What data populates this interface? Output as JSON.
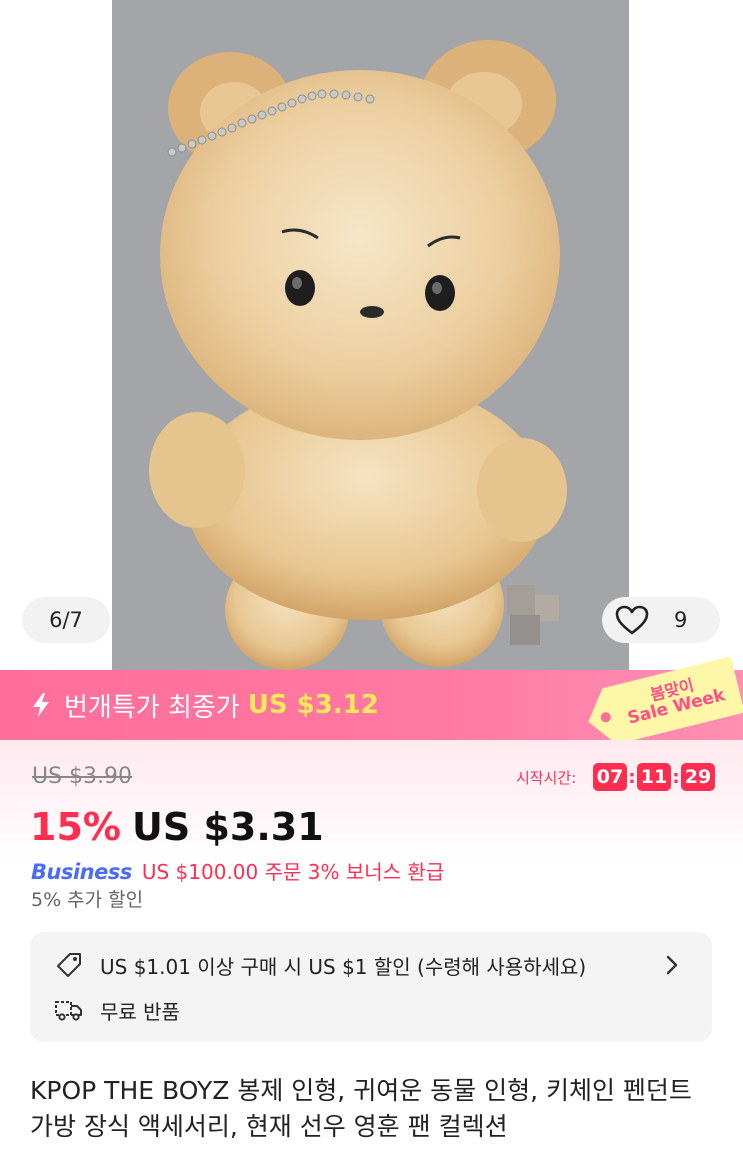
{
  "gallery": {
    "counter": "6/7",
    "favorites_count": "9"
  },
  "flash_sale": {
    "label": "번개특가 최종가",
    "price": "US $3.12"
  },
  "promo_tag": {
    "line1": "봄맞이",
    "line2": "Sale Week"
  },
  "pricing": {
    "original_price": "US $3.90",
    "start_label": "시작시간:",
    "timer": {
      "hours": "07",
      "minutes": "11",
      "seconds": "29"
    },
    "discount": "15%",
    "current_price": "US $3.31",
    "business_logo": "Business",
    "business_text": "US $100.00 주문 3% 보너스 환급",
    "extra_discount": "5% 추가 할인"
  },
  "coupon": {
    "row1": "US $1.01 이상 구매 시 US $1 할인 (수령해 사용하세요)",
    "row2": "무료 반품"
  },
  "product": {
    "title": "KPOP THE BOYZ 봉제 인형, 귀여운 동물 인형, 키체인 펜던트 가방 장식 액세서리, 현재 선우 영훈 팬 컬렉션"
  },
  "colors": {
    "accent_red": "#ff2d4f",
    "flash_pink": "#ff7aa3",
    "flash_price_yellow": "#ffe85a",
    "business_blue": "#4a6cf7"
  }
}
